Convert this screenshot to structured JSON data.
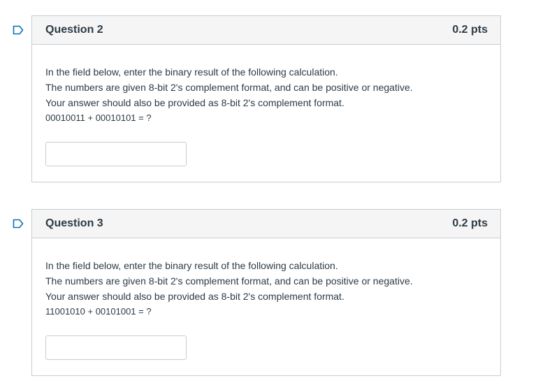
{
  "questions": [
    {
      "title": "Question 2",
      "points": "0.2 pts",
      "lines": [
        "In the field below, enter the binary result of the following calculation.",
        "The numbers are given 8-bit 2's complement format, and can be positive or negative.",
        "Your answer should also be provided as 8-bit 2's complement format.",
        "00010011 + 00010101 = ?"
      ],
      "answer_value": ""
    },
    {
      "title": "Question 3",
      "points": "0.2 pts",
      "lines": [
        "In the field below, enter the binary result of the following calculation.",
        "The numbers are given 8-bit 2's complement format, and can be positive or negative.",
        "Your answer should also be provided as 8-bit 2's complement format.",
        "11001010 + 00101001 = ?"
      ],
      "answer_value": ""
    }
  ],
  "icons": {
    "flag": "flag-question-icon"
  },
  "colors": {
    "flag": "#0374b5",
    "border": "#c7cdd1",
    "header_bg": "#f5f5f5",
    "text": "#2d3b45"
  }
}
